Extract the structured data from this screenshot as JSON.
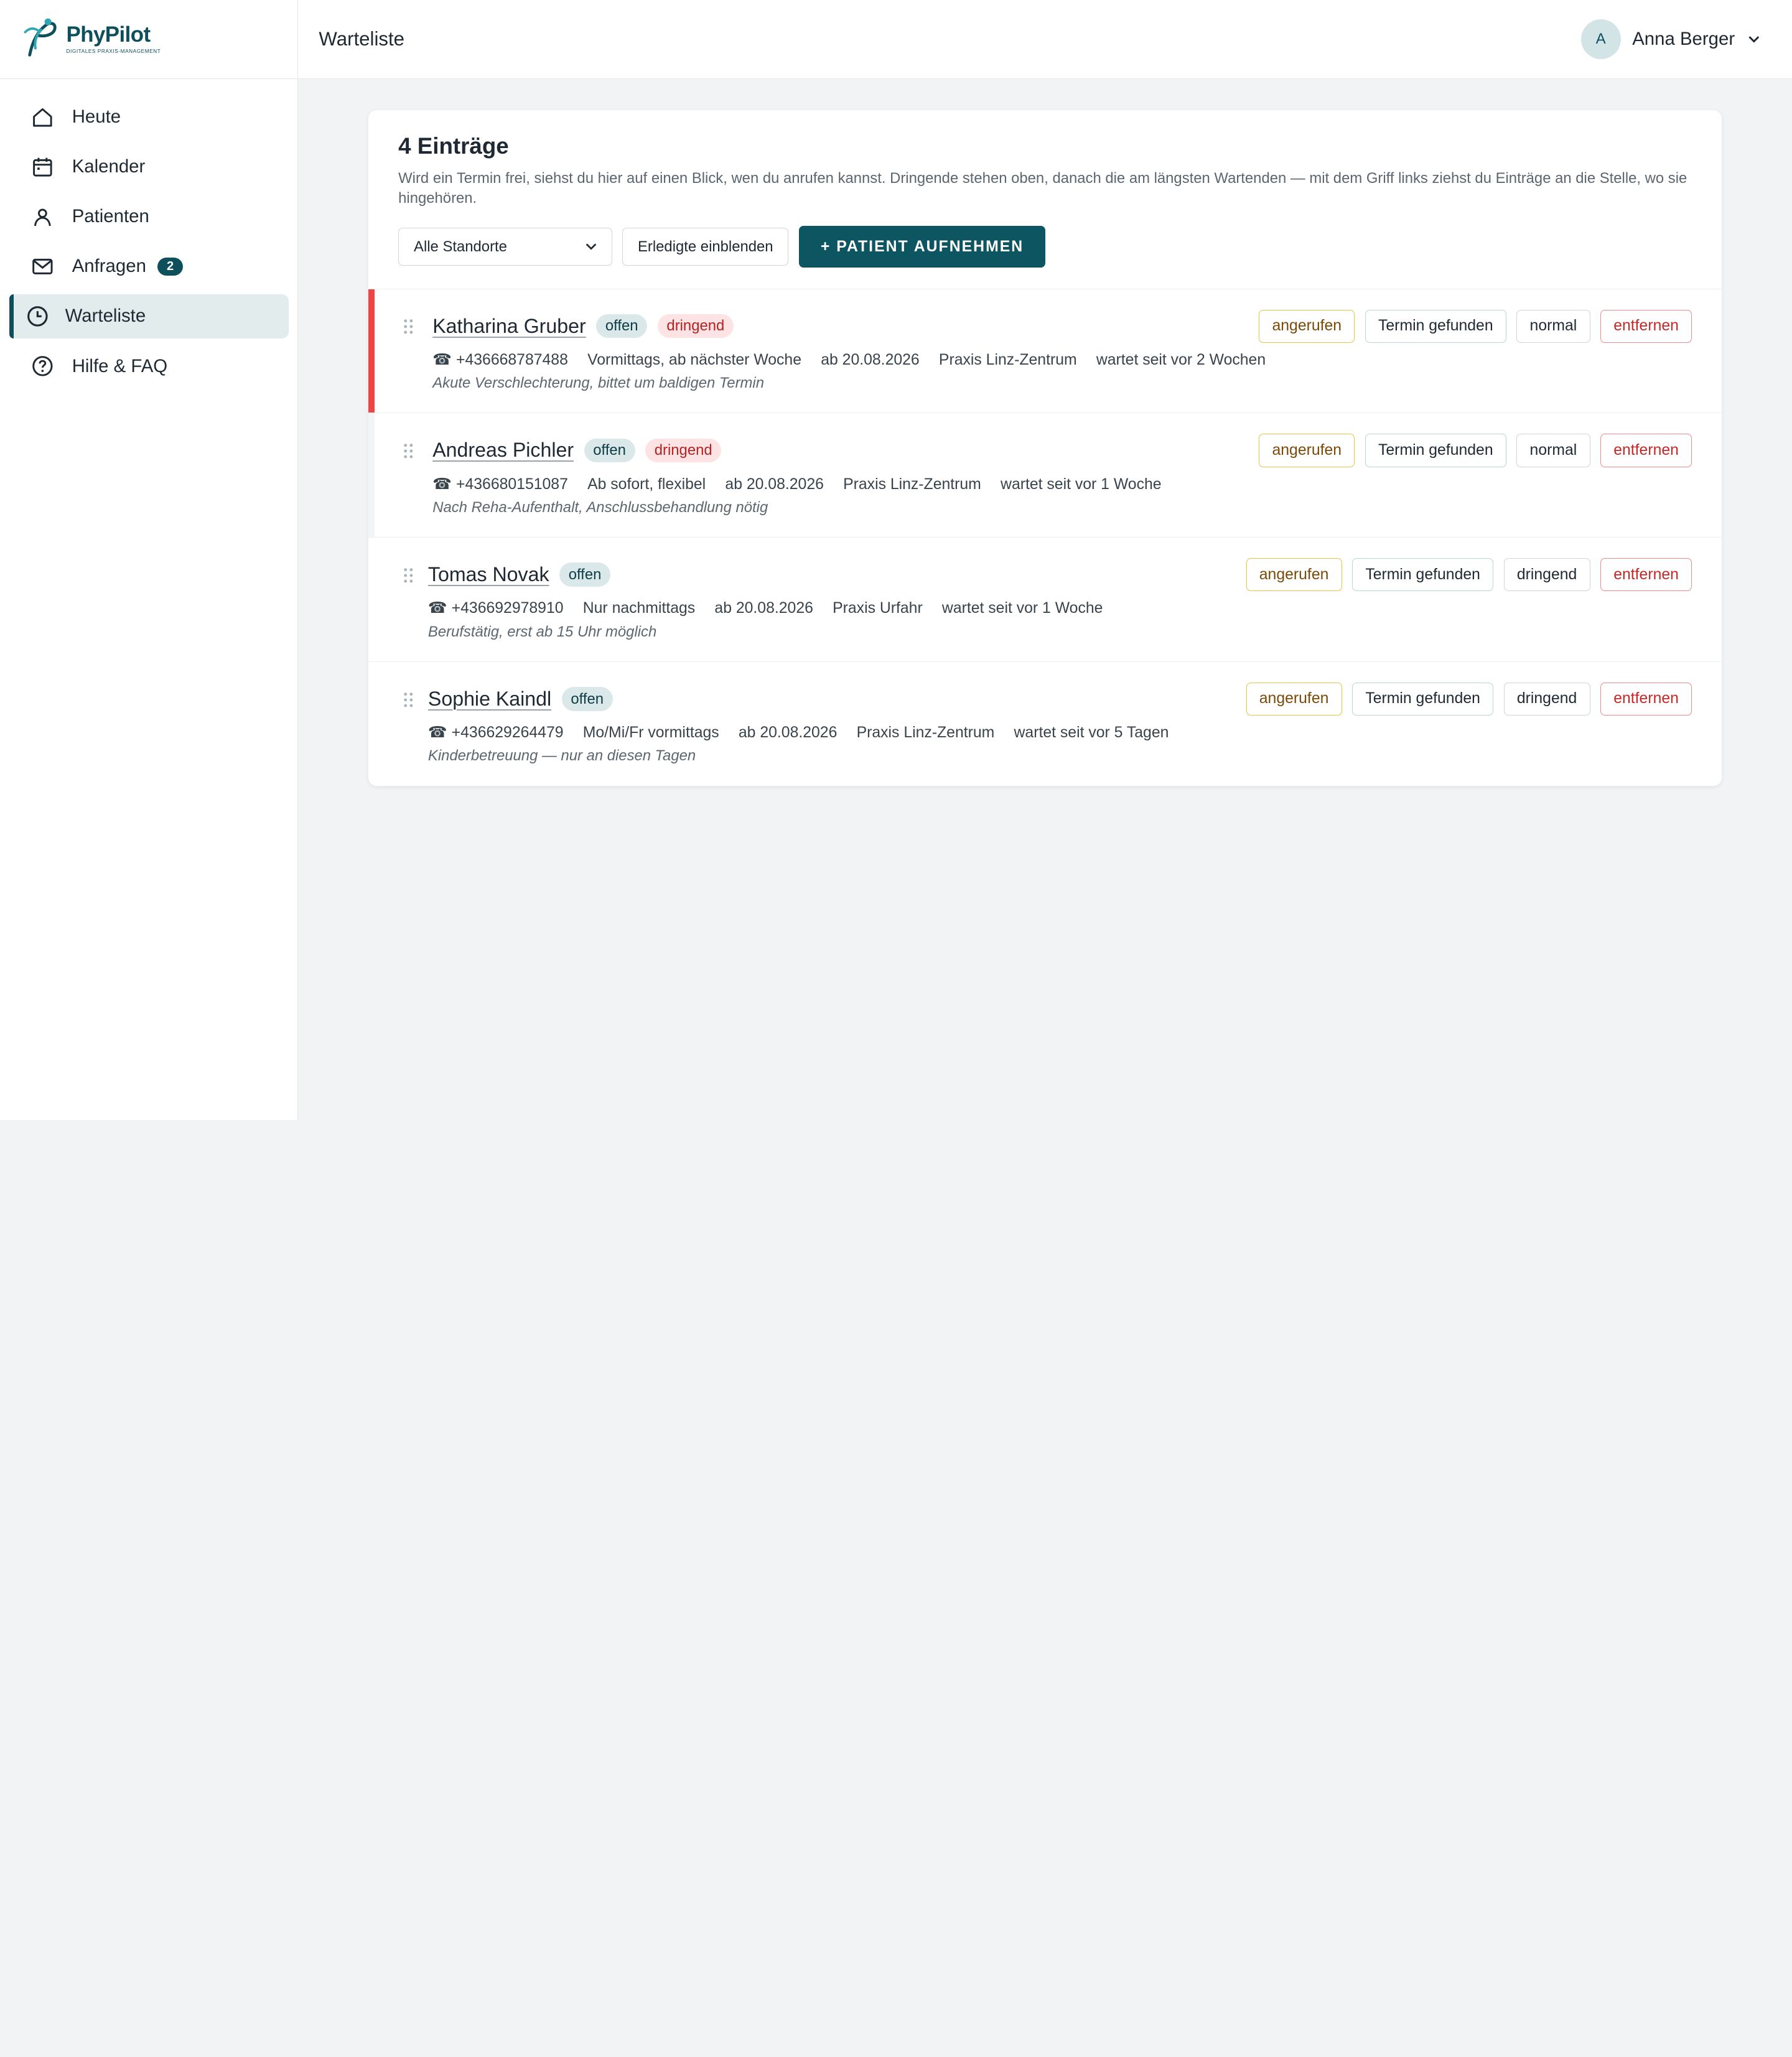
{
  "brand": {
    "name": "PhyPilot",
    "tagline": "DIGITALES PRAXIS-MANAGEMENT"
  },
  "sidebar": {
    "items": [
      {
        "label": "Heute",
        "icon": "home-icon"
      },
      {
        "label": "Kalender",
        "icon": "calendar-icon"
      },
      {
        "label": "Patienten",
        "icon": "person-icon"
      },
      {
        "label": "Anfragen",
        "icon": "mail-icon",
        "badge": "2"
      },
      {
        "label": "Warteliste",
        "icon": "clock-icon",
        "active": true
      },
      {
        "label": "Hilfe & FAQ",
        "icon": "help-icon"
      }
    ]
  },
  "header": {
    "title": "Warteliste",
    "user": {
      "initial": "A",
      "name": "Anna Berger"
    }
  },
  "card": {
    "title": "4 Einträge",
    "description": "Wird ein Termin frei, siehst du hier auf einen Blick, wen du anrufen kannst. Dringende stehen oben, danach die am längsten Wartenden — mit dem Griff links ziehst du Einträge an die Stelle, wo sie hingehören.",
    "location_select": "Alle Standorte",
    "show_done_label": "Erledigte einblenden",
    "add_patient_label": "+ PATIENT AUFNEHMEN"
  },
  "entries": [
    {
      "name": "Katharina Gruber",
      "status": "offen",
      "urgency": "dringend",
      "phone": "☎ +436668787488",
      "availability": "Vormittags, ab nächster Woche",
      "from": "ab 20.08.2026",
      "location": "Praxis Linz-Zentrum",
      "waiting": "wartet seit vor 2 Wochen",
      "note": "Akute Verschlechterung, bittet um baldigen Termin",
      "actions": {
        "called": "angerufen",
        "found": "Termin gefunden",
        "priority": "normal",
        "remove": "entfernen"
      }
    },
    {
      "name": "Andreas Pichler",
      "status": "offen",
      "urgency": "dringend",
      "phone": "☎ +436680151087",
      "availability": "Ab sofort, flexibel",
      "from": "ab 20.08.2026",
      "location": "Praxis Linz-Zentrum",
      "waiting": "wartet seit vor 1 Woche",
      "note": "Nach Reha-Aufenthalt, Anschlussbehandlung nötig",
      "actions": {
        "called": "angerufen",
        "found": "Termin gefunden",
        "priority": "normal",
        "remove": "entfernen"
      }
    },
    {
      "name": "Tomas Novak",
      "status": "offen",
      "phone": "☎ +436692978910",
      "availability": "Nur nachmittags",
      "from": "ab 20.08.2026",
      "location": "Praxis Urfahr",
      "waiting": "wartet seit vor 1 Woche",
      "note": "Berufstätig, erst ab 15 Uhr möglich",
      "actions": {
        "called": "angerufen",
        "found": "Termin gefunden",
        "priority": "dringend",
        "remove": "entfernen"
      }
    },
    {
      "name": "Sophie Kaindl",
      "status": "offen",
      "phone": "☎ +436629264479",
      "availability": "Mo/Mi/Fr vormittags",
      "from": "ab 20.08.2026",
      "location": "Praxis Linz-Zentrum",
      "waiting": "wartet seit vor 5 Tagen",
      "note": "Kinderbetreuung — nur an diesen Tagen",
      "actions": {
        "called": "angerufen",
        "found": "Termin gefunden",
        "priority": "dringend",
        "remove": "entfernen"
      }
    }
  ],
  "colors": {
    "primary": "#0e5562",
    "urgent_bar": "#ef4444",
    "background": "#f2f3f4"
  }
}
